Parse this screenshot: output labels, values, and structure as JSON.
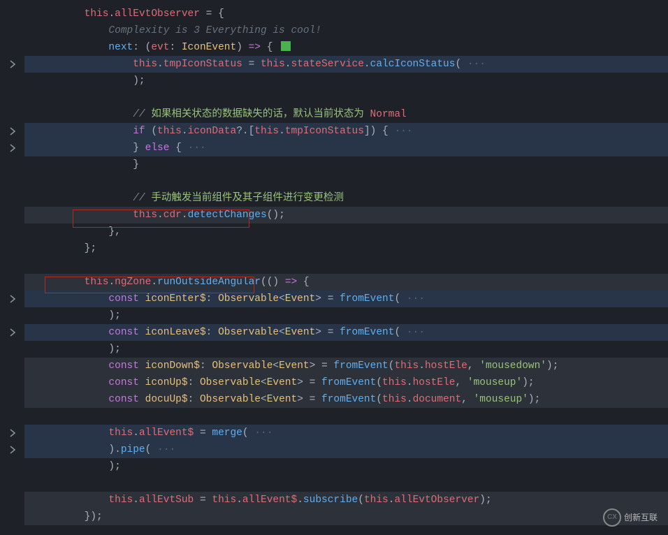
{
  "lines": [
    {
      "fold": false,
      "hl": "",
      "indent": 4,
      "tokens": [
        [
          "this",
          "this"
        ],
        [
          "punct",
          "."
        ],
        [
          "prop",
          "allEvtObserver"
        ],
        [
          "punct",
          " = {"
        ]
      ]
    },
    {
      "fold": false,
      "hl": "",
      "indent": 6,
      "tokens": [
        [
          "hint",
          "Complexity is 3 Everything is cool!"
        ]
      ]
    },
    {
      "fold": false,
      "hl": "",
      "indent": 6,
      "tokens": [
        [
          "method",
          "next"
        ],
        [
          "punct",
          ": ("
        ],
        [
          "param",
          "evt"
        ],
        [
          "punct",
          ": "
        ],
        [
          "type",
          "IconEvent"
        ],
        [
          "punct",
          ") "
        ],
        [
          "arrow",
          "=>"
        ],
        [
          "punct",
          " { "
        ],
        [
          "greensq",
          ""
        ]
      ]
    },
    {
      "fold": true,
      "hl": "sel2",
      "indent": 8,
      "tokens": [
        [
          "this",
          "this"
        ],
        [
          "punct",
          "."
        ],
        [
          "prop",
          "tmpIconStatus"
        ],
        [
          "punct",
          " = "
        ],
        [
          "this",
          "this"
        ],
        [
          "punct",
          "."
        ],
        [
          "prop",
          "stateService"
        ],
        [
          "punct",
          "."
        ],
        [
          "method",
          "calcIconStatus"
        ],
        [
          "punct",
          "("
        ],
        [
          "dim",
          " ···"
        ]
      ]
    },
    {
      "fold": false,
      "hl": "",
      "indent": 8,
      "tokens": [
        [
          "punct",
          ");"
        ]
      ]
    },
    {
      "fold": false,
      "hl": "",
      "indent": 8,
      "tokens": []
    },
    {
      "fold": false,
      "hl": "",
      "indent": 8,
      "tokens": [
        [
          "comment",
          "// "
        ],
        [
          "commentgreen",
          "如果相关状态的数据缺失的话，默认当前状态为 "
        ],
        [
          "prop",
          "Normal"
        ]
      ]
    },
    {
      "fold": true,
      "hl": "sel2",
      "indent": 8,
      "tokens": [
        [
          "keyword",
          "if"
        ],
        [
          "punct",
          " ("
        ],
        [
          "this",
          "this"
        ],
        [
          "punct",
          "."
        ],
        [
          "prop",
          "iconData"
        ],
        [
          "punct",
          "?.["
        ],
        [
          "this",
          "this"
        ],
        [
          "punct",
          "."
        ],
        [
          "prop",
          "tmpIconStatus"
        ],
        [
          "punct",
          "]) {"
        ],
        [
          "dim",
          " ···"
        ]
      ]
    },
    {
      "fold": true,
      "hl": "sel2",
      "indent": 8,
      "tokens": [
        [
          "punct",
          "} "
        ],
        [
          "keyword",
          "else"
        ],
        [
          "punct",
          " {"
        ],
        [
          "dim",
          " ···"
        ]
      ]
    },
    {
      "fold": false,
      "hl": "",
      "indent": 8,
      "tokens": [
        [
          "punct",
          "}"
        ]
      ]
    },
    {
      "fold": false,
      "hl": "",
      "indent": 8,
      "tokens": []
    },
    {
      "fold": false,
      "hl": "",
      "indent": 8,
      "tokens": [
        [
          "comment",
          "// "
        ],
        [
          "commentgreen",
          "手动触发当前组件及其子组件进行变更检测"
        ]
      ]
    },
    {
      "fold": false,
      "hl": "sel",
      "indent": 8,
      "tokens": [
        [
          "this",
          "this"
        ],
        [
          "punct",
          "."
        ],
        [
          "prop",
          "cdr"
        ],
        [
          "punct",
          "."
        ],
        [
          "method",
          "detectChanges"
        ],
        [
          "punct",
          "();"
        ]
      ]
    },
    {
      "fold": false,
      "hl": "",
      "indent": 6,
      "tokens": [
        [
          "punct",
          "},"
        ]
      ]
    },
    {
      "fold": false,
      "hl": "",
      "indent": 4,
      "tokens": [
        [
          "punct",
          "};"
        ]
      ]
    },
    {
      "fold": false,
      "hl": "",
      "indent": 4,
      "tokens": []
    },
    {
      "fold": false,
      "hl": "sel",
      "indent": 4,
      "tokens": [
        [
          "this",
          "this"
        ],
        [
          "punct",
          "."
        ],
        [
          "prop",
          "ngZone"
        ],
        [
          "punct",
          "."
        ],
        [
          "method",
          "runOutsideAngular"
        ],
        [
          "punct",
          "(() "
        ],
        [
          "arrow",
          "=>"
        ],
        [
          "punct",
          " {"
        ]
      ]
    },
    {
      "fold": true,
      "hl": "sel2",
      "indent": 6,
      "tokens": [
        [
          "keyword",
          "const"
        ],
        [
          "punct",
          " "
        ],
        [
          "const",
          "iconEnter$"
        ],
        [
          "punct",
          ": "
        ],
        [
          "type",
          "Observable"
        ],
        [
          "punct",
          "<"
        ],
        [
          "type",
          "Event"
        ],
        [
          "punct",
          "> = "
        ],
        [
          "method",
          "fromEvent"
        ],
        [
          "punct",
          "("
        ],
        [
          "dim",
          " ···"
        ]
      ]
    },
    {
      "fold": false,
      "hl": "",
      "indent": 6,
      "tokens": [
        [
          "punct",
          ");"
        ]
      ]
    },
    {
      "fold": true,
      "hl": "sel2",
      "indent": 6,
      "tokens": [
        [
          "keyword",
          "const"
        ],
        [
          "punct",
          " "
        ],
        [
          "const",
          "iconLeave$"
        ],
        [
          "punct",
          ": "
        ],
        [
          "type",
          "Observable"
        ],
        [
          "punct",
          "<"
        ],
        [
          "type",
          "Event"
        ],
        [
          "punct",
          "> = "
        ],
        [
          "method",
          "fromEvent"
        ],
        [
          "punct",
          "("
        ],
        [
          "dim",
          " ···"
        ]
      ]
    },
    {
      "fold": false,
      "hl": "",
      "indent": 6,
      "tokens": [
        [
          "punct",
          ");"
        ]
      ]
    },
    {
      "fold": false,
      "hl": "sel",
      "indent": 6,
      "tokens": [
        [
          "keyword",
          "const"
        ],
        [
          "punct",
          " "
        ],
        [
          "const",
          "iconDown$"
        ],
        [
          "punct",
          ": "
        ],
        [
          "type",
          "Observable"
        ],
        [
          "punct",
          "<"
        ],
        [
          "type",
          "Event"
        ],
        [
          "punct",
          "> = "
        ],
        [
          "method",
          "fromEvent"
        ],
        [
          "punct",
          "("
        ],
        [
          "this",
          "this"
        ],
        [
          "punct",
          "."
        ],
        [
          "prop",
          "hostEle"
        ],
        [
          "punct",
          ", "
        ],
        [
          "string",
          "'mousedown'"
        ],
        [
          "punct",
          ");"
        ]
      ]
    },
    {
      "fold": false,
      "hl": "sel",
      "indent": 6,
      "tokens": [
        [
          "keyword",
          "const"
        ],
        [
          "punct",
          " "
        ],
        [
          "const",
          "iconUp$"
        ],
        [
          "punct",
          ": "
        ],
        [
          "type",
          "Observable"
        ],
        [
          "punct",
          "<"
        ],
        [
          "type",
          "Event"
        ],
        [
          "punct",
          "> = "
        ],
        [
          "method",
          "fromEvent"
        ],
        [
          "punct",
          "("
        ],
        [
          "this",
          "this"
        ],
        [
          "punct",
          "."
        ],
        [
          "prop",
          "hostEle"
        ],
        [
          "punct",
          ", "
        ],
        [
          "string",
          "'mouseup'"
        ],
        [
          "punct",
          ");"
        ]
      ]
    },
    {
      "fold": false,
      "hl": "sel",
      "indent": 6,
      "tokens": [
        [
          "keyword",
          "const"
        ],
        [
          "punct",
          " "
        ],
        [
          "const",
          "docuUp$"
        ],
        [
          "punct",
          ": "
        ],
        [
          "type",
          "Observable"
        ],
        [
          "punct",
          "<"
        ],
        [
          "type",
          "Event"
        ],
        [
          "punct",
          "> = "
        ],
        [
          "method",
          "fromEvent"
        ],
        [
          "punct",
          "("
        ],
        [
          "this",
          "this"
        ],
        [
          "punct",
          "."
        ],
        [
          "prop",
          "document"
        ],
        [
          "punct",
          ", "
        ],
        [
          "string",
          "'mouseup'"
        ],
        [
          "punct",
          ");"
        ]
      ]
    },
    {
      "fold": false,
      "hl": "",
      "indent": 6,
      "tokens": []
    },
    {
      "fold": true,
      "hl": "sel2",
      "indent": 6,
      "tokens": [
        [
          "this",
          "this"
        ],
        [
          "punct",
          "."
        ],
        [
          "prop",
          "allEvent$"
        ],
        [
          "punct",
          " = "
        ],
        [
          "method",
          "merge"
        ],
        [
          "punct",
          "("
        ],
        [
          "dim",
          " ···"
        ]
      ]
    },
    {
      "fold": true,
      "hl": "sel2",
      "indent": 6,
      "tokens": [
        [
          "punct",
          ")."
        ],
        [
          "method",
          "pipe"
        ],
        [
          "punct",
          "("
        ],
        [
          "dim",
          " ···"
        ]
      ]
    },
    {
      "fold": false,
      "hl": "",
      "indent": 6,
      "tokens": [
        [
          "punct",
          ");"
        ]
      ]
    },
    {
      "fold": false,
      "hl": "",
      "indent": 6,
      "tokens": []
    },
    {
      "fold": false,
      "hl": "sel",
      "indent": 6,
      "tokens": [
        [
          "this",
          "this"
        ],
        [
          "punct",
          "."
        ],
        [
          "prop",
          "allEvtSub"
        ],
        [
          "punct",
          " = "
        ],
        [
          "this",
          "this"
        ],
        [
          "punct",
          "."
        ],
        [
          "prop",
          "allEvent$"
        ],
        [
          "punct",
          "."
        ],
        [
          "method",
          "subscribe"
        ],
        [
          "punct",
          "("
        ],
        [
          "this",
          "this"
        ],
        [
          "punct",
          "."
        ],
        [
          "prop",
          "allEvtObserver"
        ],
        [
          "punct",
          ");"
        ]
      ]
    },
    {
      "fold": false,
      "hl": "sel",
      "indent": 4,
      "tokens": [
        [
          "punct",
          "});"
        ]
      ]
    }
  ],
  "highlight_boxes": [
    "this.cdr.detectChanges();",
    "this.ngZone.runOutsideAngular("
  ],
  "watermark": "创新互联"
}
